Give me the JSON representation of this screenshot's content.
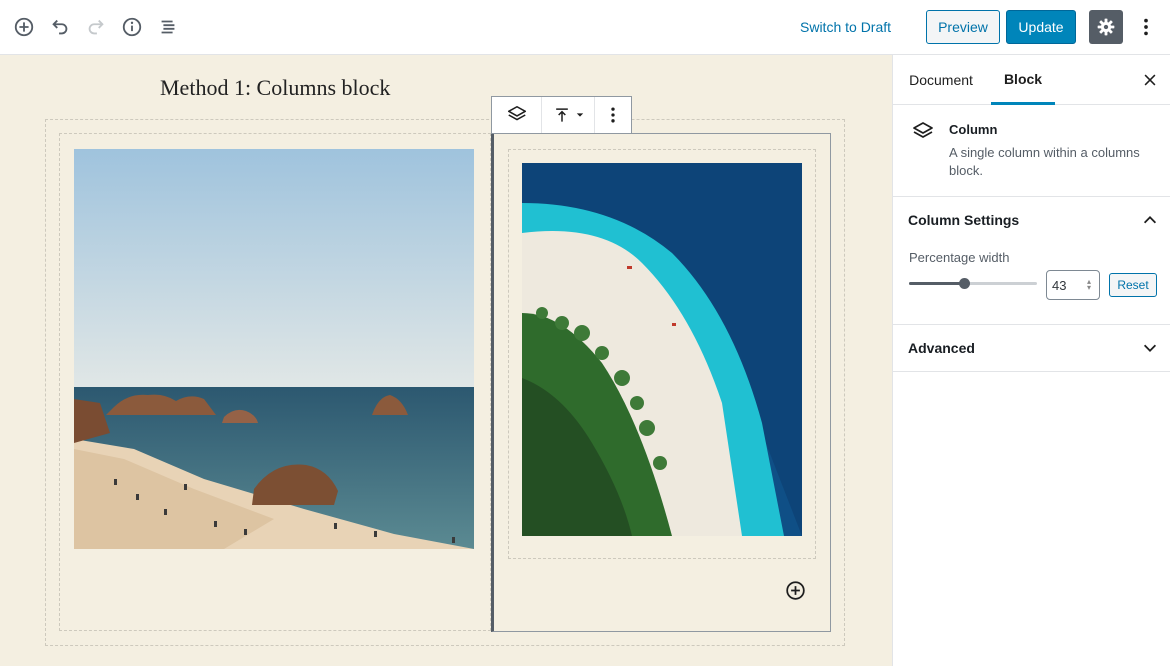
{
  "toolbar": {
    "icons": [
      "add-block-icon",
      "undo-icon",
      "redo-icon",
      "info-icon",
      "outline-icon"
    ],
    "switch_to_draft": "Switch to Draft",
    "preview": "Preview",
    "update": "Update",
    "settings_icon": "gear-icon",
    "more_icon": "more-vertical-icon"
  },
  "colors": {
    "accent": "#0085ba",
    "link": "#0073aa",
    "canvas": "#f4efe1",
    "settings_bg": "#555d66"
  },
  "editor": {
    "heading": "Method 1: Columns block",
    "block_toolbar": {
      "icons": [
        "column-block-icon",
        "vertical-align-top-icon",
        "more-vertical-icon"
      ]
    },
    "images": [
      "beach-with-rocks-photo",
      "aerial-beach-photo"
    ]
  },
  "sidebar": {
    "tabs": [
      {
        "label": "Document"
      },
      {
        "label": "Block"
      }
    ],
    "active_tab": "Block",
    "block_card": {
      "title": "Column",
      "description": "A single column within a columns block."
    },
    "column_settings": {
      "title": "Column Settings",
      "expanded": true,
      "percentage_label": "Percentage width",
      "percentage_value": "43",
      "percentage_fraction": 0.43,
      "reset": "Reset"
    },
    "advanced": {
      "title": "Advanced",
      "expanded": false
    }
  }
}
